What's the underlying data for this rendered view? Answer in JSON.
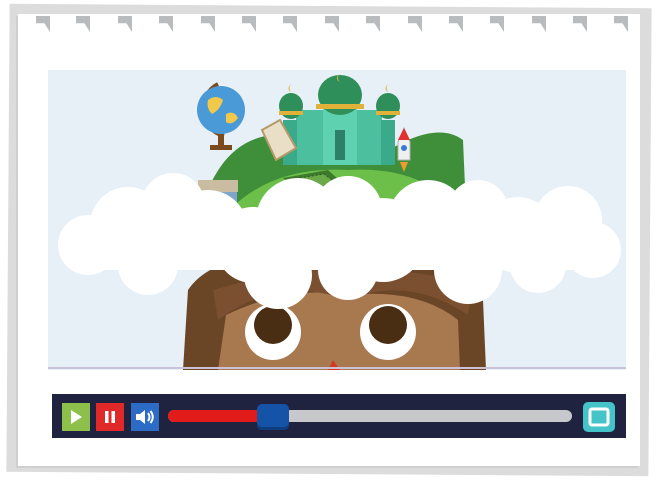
{
  "player": {
    "progress": 0.26,
    "buttons": {
      "play": "play-icon",
      "pause": "pause-icon",
      "volume": "volume-icon",
      "fullscreen": "fullscreen-icon"
    },
    "colors": {
      "bar": "#1f2340",
      "play": "#8dc04a",
      "pause": "#e02a2a",
      "volume": "#2c6cc5",
      "progress": "#e21b1b",
      "thumb": "#1453a8",
      "fullscreen": "#44c3c9"
    }
  },
  "scene": {
    "depicts": [
      "globe-icon",
      "mosque",
      "rocket-icon",
      "books",
      "clouds",
      "child-face"
    ]
  }
}
